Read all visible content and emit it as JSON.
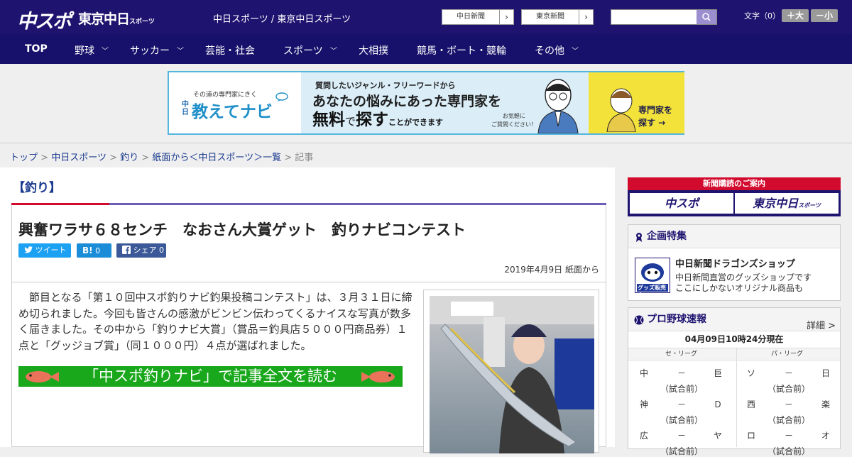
{
  "header": {
    "logo_main": "中スポ",
    "logo_sub": "東京中日",
    "logo_sub_small": "スポーツ",
    "site_names": "中日スポーツ / 東京中日スポーツ",
    "paper_buttons": [
      "中日新聞",
      "東京新聞"
    ],
    "font_size_label": "文字（0）",
    "font_bigger": "＋大",
    "font_smaller": "－小"
  },
  "nav": {
    "items": [
      "TOP",
      "野球",
      "サッカー",
      "芸能・社会",
      "スポーツ",
      "大相撲",
      "競馬・ボート・競輪",
      "その他"
    ]
  },
  "banner": {
    "tagline": "その道の専門家にきく",
    "brand": "教えてナビ",
    "brand_prefix": "中日",
    "line1": "質問したいジャンル・フリーワードから",
    "line2": "あなたの悩みにあった専門家を",
    "line3a": "無料",
    "line3b": "で",
    "line3c": "探す",
    "line3d": "ことができます",
    "note1": "お気軽に",
    "note2": "ご質問ください！",
    "cta1": "専門家を",
    "cta2": "探す →"
  },
  "breadcrumb": {
    "items": [
      "トップ",
      "中日スポーツ",
      "釣り",
      "紙面から＜中日スポーツ＞一覧"
    ],
    "separator": ">",
    "current": "記事"
  },
  "article": {
    "category": "【釣り】",
    "title": "興奮ワラサ６８センチ　なおさん大賞ゲット　釣りナビコンテスト",
    "tweet": "ツイート",
    "hatebu": "B!",
    "hatebu_count": "0",
    "share": "シェア",
    "share_count": "0",
    "date": "2019年4月9日 紙面から",
    "body": "節目となる「第１０回中スポ釣りナビ釣果投稿コンテスト」は、３月３１日に締め切られました。今回も皆さんの感激がビンビン伝わってくるナイスな写真が数多く届きました。その中から「釣りナビ大賞」（賞品＝釣具店５０００円商品券）１点と「グッジョブ賞」（同１０００円）４点が選ばれました。",
    "read_more": "「中スポ釣りナビ」で記事全文を読む"
  },
  "sidebar": {
    "subscribe_header": "新聞購読のご案内",
    "subscribe_btn1": "中スポ",
    "subscribe_btn2": "東京中日",
    "subscribe_btn2_small": "スポーツ",
    "feature_header": "企画特集",
    "shop_title": "中日新聞ドラゴンズショップ",
    "shop_line1": "中日新聞直営のグッズショップです",
    "shop_line2": "ここにしかないオリジナル商品も",
    "shop_badge": "グッズ販売中",
    "baseball_header": "プロ野球速報",
    "baseball_detail": "詳細 >",
    "asof": "04月09日10時24分現在",
    "central_league": "セ・リーグ",
    "pacific_league": "パ・リーグ",
    "central_games": [
      {
        "home": "中",
        "score": "－",
        "away": "巨",
        "status": "（試合前）"
      },
      {
        "home": "神",
        "score": "－",
        "away": "Ｄ",
        "status": "（試合前）"
      },
      {
        "home": "広",
        "score": "－",
        "away": "ヤ",
        "status": "（試合前）"
      }
    ],
    "pacific_games": [
      {
        "home": "ソ",
        "score": "－",
        "away": "日",
        "status": "（試合前）"
      },
      {
        "home": "西",
        "score": "－",
        "away": "楽",
        "status": "（試合前）"
      },
      {
        "home": "ロ",
        "score": "－",
        "away": "オ",
        "status": "（試合前）"
      }
    ]
  },
  "colors": {
    "header_bg": "#1e1470",
    "accent_red": "#d20a2e",
    "accent_purple": "#6d5db7",
    "read_more_green": "#19a71b"
  }
}
